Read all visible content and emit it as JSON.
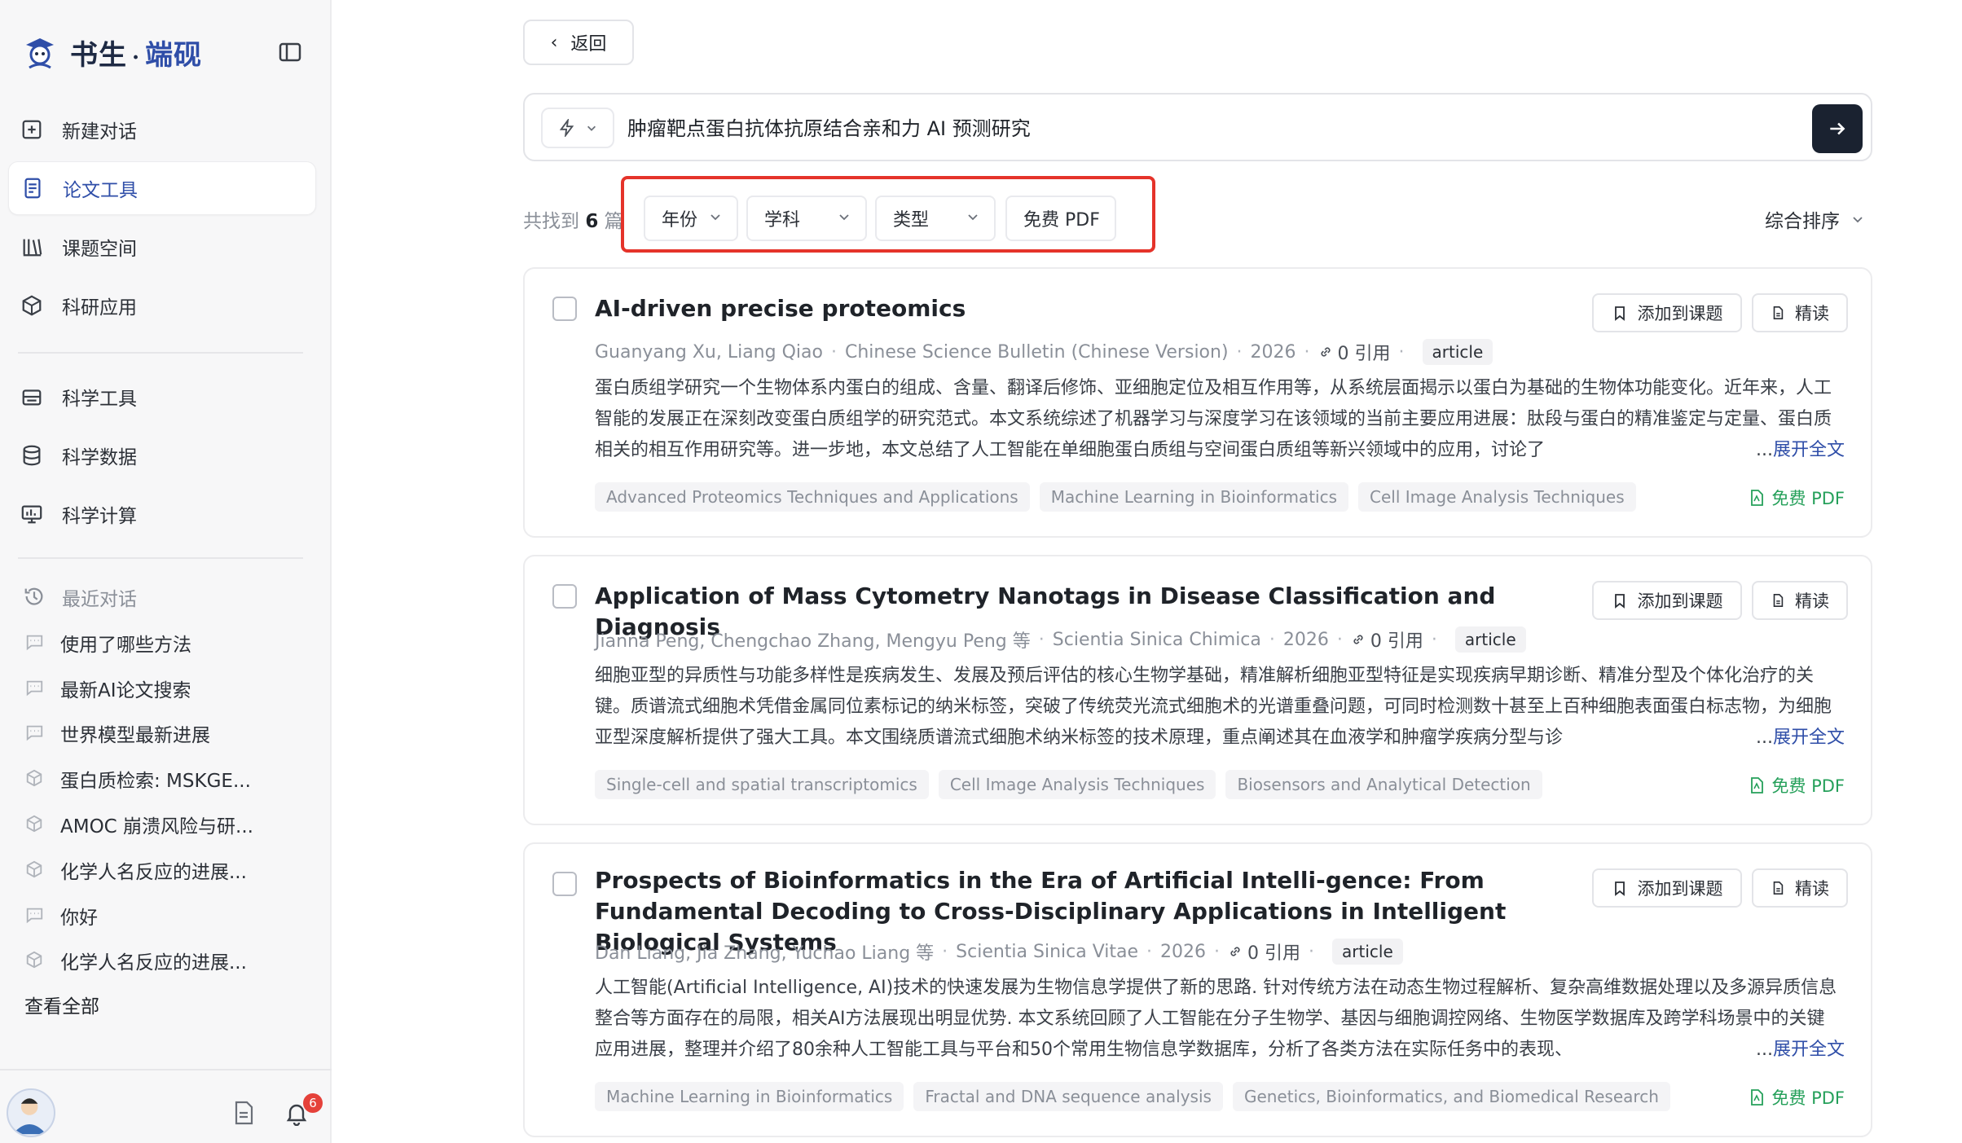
{
  "brand": {
    "name_part1": "书生",
    "separator": "·",
    "name_part2": "端砚"
  },
  "sidebar": {
    "nav": [
      {
        "label": "新建对话",
        "icon": "plus-square-icon"
      },
      {
        "label": "论文工具",
        "icon": "document-list-icon",
        "active": true
      },
      {
        "label": "课题空间",
        "icon": "books-icon"
      },
      {
        "label": "科研应用",
        "icon": "cube-icon"
      }
    ],
    "nav2": [
      {
        "label": "科学工具",
        "icon": "toolbox-icon"
      },
      {
        "label": "科学数据",
        "icon": "database-icon"
      },
      {
        "label": "科学计算",
        "icon": "monitor-chart-icon"
      }
    ],
    "recent_title": "最近对话",
    "recent": [
      {
        "label": "使用了哪些方法",
        "icon": "chat-icon"
      },
      {
        "label": "最新AI论文搜索",
        "icon": "chat-icon"
      },
      {
        "label": "世界模型最新进展",
        "icon": "chat-icon"
      },
      {
        "label": "蛋白质检索: MSKGE...",
        "icon": "cube-icon"
      },
      {
        "label": "AMOC 崩溃风险与研...",
        "icon": "cube-icon"
      },
      {
        "label": "化学人名反应的进展...",
        "icon": "cube-icon"
      },
      {
        "label": "你好",
        "icon": "chat-icon"
      },
      {
        "label": "化学人名反应的进展...",
        "icon": "cube-icon"
      }
    ],
    "view_all": "查看全部",
    "notification_count": "6"
  },
  "back_label": "返回",
  "search": {
    "query": "肿瘤靶点蛋白抗体抗原结合亲和力 AI 预测研究"
  },
  "results": {
    "prefix": "共找到",
    "count": "6",
    "suffix": "篇"
  },
  "filters": {
    "year": "年份",
    "subject": "学科",
    "type": "类型",
    "free_pdf": "免费 PDF"
  },
  "sort_label": "综合排序",
  "card_actions": {
    "add": "添加到课题",
    "read": "精读",
    "more": "展开全文",
    "ellipsis": "...",
    "pdf": "免费 PDF"
  },
  "papers": [
    {
      "title": "AI-driven precise proteomics",
      "authors": "Guanyang Xu, Liang Qiao",
      "journal": "Chinese Science Bulletin (Chinese Version)",
      "year": "2026",
      "citations": "0 引用",
      "type": "article",
      "abstract": "蛋白质组学研究一个生物体系内蛋白的组成、含量、翻译后修饰、亚细胞定位及相互作用等，从系统层面揭示以蛋白为基础的生物体功能变化。近年来，人工智能的发展正在深刻改变蛋白质组学的研究范式。本文系统综述了机器学习与深度学习在该领域的当前主要应用进展：肽段与蛋白的精准鉴定与定量、蛋白质相关的相互作用研究等。进一步地，本文总结了人工智能在单细胞蛋白质组与空间蛋白质组等新兴领域中的应用，讨论了",
      "keywords": [
        "Advanced Proteomics Techniques and Applications",
        "Machine Learning in Bioinformatics",
        "Cell Image Analysis Techniques"
      ]
    },
    {
      "title": "Application of Mass Cytometry Nanotags in Disease Classification and Diagnosis",
      "authors": "Jianna Peng, Chengchao Zhang, Mengyu Peng 等",
      "journal": "Scientia Sinica Chimica",
      "year": "2026",
      "citations": "0 引用",
      "type": "article",
      "abstract": "细胞亚型的异质性与功能多样性是疾病发生、发展及预后评估的核心生物学基础，精准解析细胞亚型特征是实现疾病早期诊断、精准分型及个体化治疗的关键。质谱流式细胞术凭借金属同位素标记的纳米标签，突破了传统荧光流式细胞术的光谱重叠问题，可同时检测数十甚至上百种细胞表面蛋白标志物，为细胞亚型深度解析提供了强大工具。本文围绕质谱流式细胞术纳米标签的技术原理，重点阐述其在血液学和肿瘤学疾病分型与诊",
      "keywords": [
        "Single-cell and spatial transcriptomics",
        "Cell Image Analysis Techniques",
        "Biosensors and Analytical Detection"
      ]
    },
    {
      "title": "Prospects of Bioinformatics in the Era of Artificial Intelli-gence: From Fundamental Decoding to Cross-Disciplinary Applications in Intelligent Biological Systems",
      "authors": "Dan Liang, Jia Zhang, Yuchao Liang 等",
      "journal": "Scientia Sinica Vitae",
      "year": "2026",
      "citations": "0 引用",
      "type": "article",
      "abstract": "人工智能(Artificial Intelligence, AI)技术的快速发展为生物信息学提供了新的思路. 针对传统方法在动态生物过程解析、复杂高维数据处理以及多源异质信息整合等方面存在的局限，相关AI方法展现出明显优势. 本文系统回顾了人工智能在分子生物学、基因与细胞调控网络、生物医学数据库及跨学科场景中的关键应用进展，整理并介绍了80余种人工智能工具与平台和50个常用生物信息学数据库，分析了各类方法在实际任务中的表现、",
      "keywords": [
        "Machine Learning in Bioinformatics",
        "Fractal and DNA sequence analysis",
        "Genetics, Bioinformatics, and Biomedical Research"
      ]
    }
  ]
}
